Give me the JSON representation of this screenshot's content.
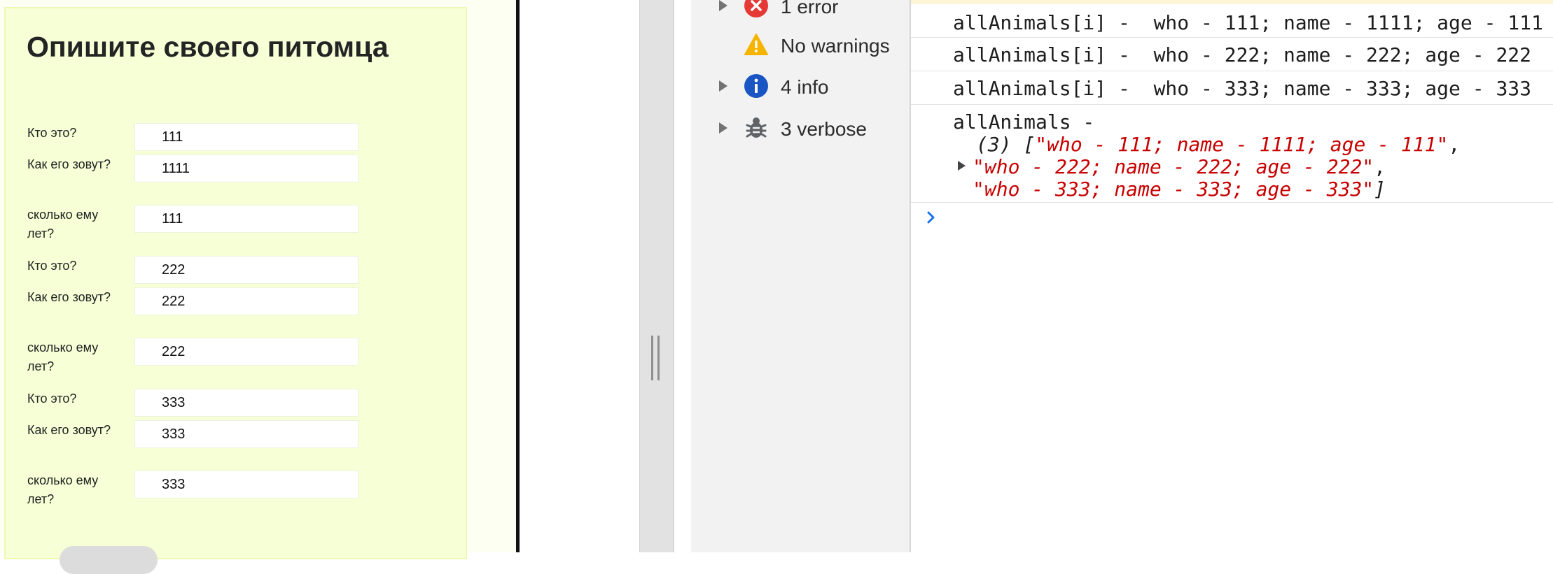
{
  "form": {
    "title": "Опишите своего питомца",
    "fields": [
      {
        "label": "Кто это?",
        "value": "111"
      },
      {
        "label": "Как его зовут?",
        "value": "1111"
      },
      {
        "label": "сколько ему лет?",
        "value": "111"
      },
      {
        "label": "Кто это?",
        "value": "222"
      },
      {
        "label": "Как его зовут?",
        "value": "222"
      },
      {
        "label": "сколько ему лет?",
        "value": "222"
      },
      {
        "label": "Кто это?",
        "value": "333"
      },
      {
        "label": "Как его зовут?",
        "value": "333"
      },
      {
        "label": "сколько ему лет?",
        "value": "333"
      }
    ]
  },
  "sidebar": {
    "items": [
      {
        "label": "1 error",
        "icon": "error-icon",
        "color": "#e53935"
      },
      {
        "label": "No warnings",
        "icon": "warning-icon",
        "color": "#f4b400"
      },
      {
        "label": "4 info",
        "icon": "info-icon",
        "color": "#1a73e8"
      },
      {
        "label": "3 verbose",
        "icon": "bug-icon",
        "color": "#5f6368"
      }
    ]
  },
  "console": {
    "logs": [
      "allAnimals[i] -  who - 111; name - 1111; age - 111",
      "allAnimals[i] -  who - 222; name - 222; age - 222",
      "allAnimals[i] -  who - 333; name - 333; age - 333"
    ],
    "array_log": {
      "head": "allAnimals -",
      "count": "(3)",
      "open_bracket": "[",
      "close_bracket": "]",
      "items": [
        "\"who - 111; name - 1111; age - 111\"",
        "\"who - 222; name - 222; age - 222\"",
        "\"who - 333; name - 333; age - 333\""
      ]
    },
    "prompt_icon": "chevron-right-icon"
  },
  "colors": {
    "form_background": "#f7ffd6",
    "string_red": "#c80000",
    "prompt_blue": "#1a73e8"
  }
}
